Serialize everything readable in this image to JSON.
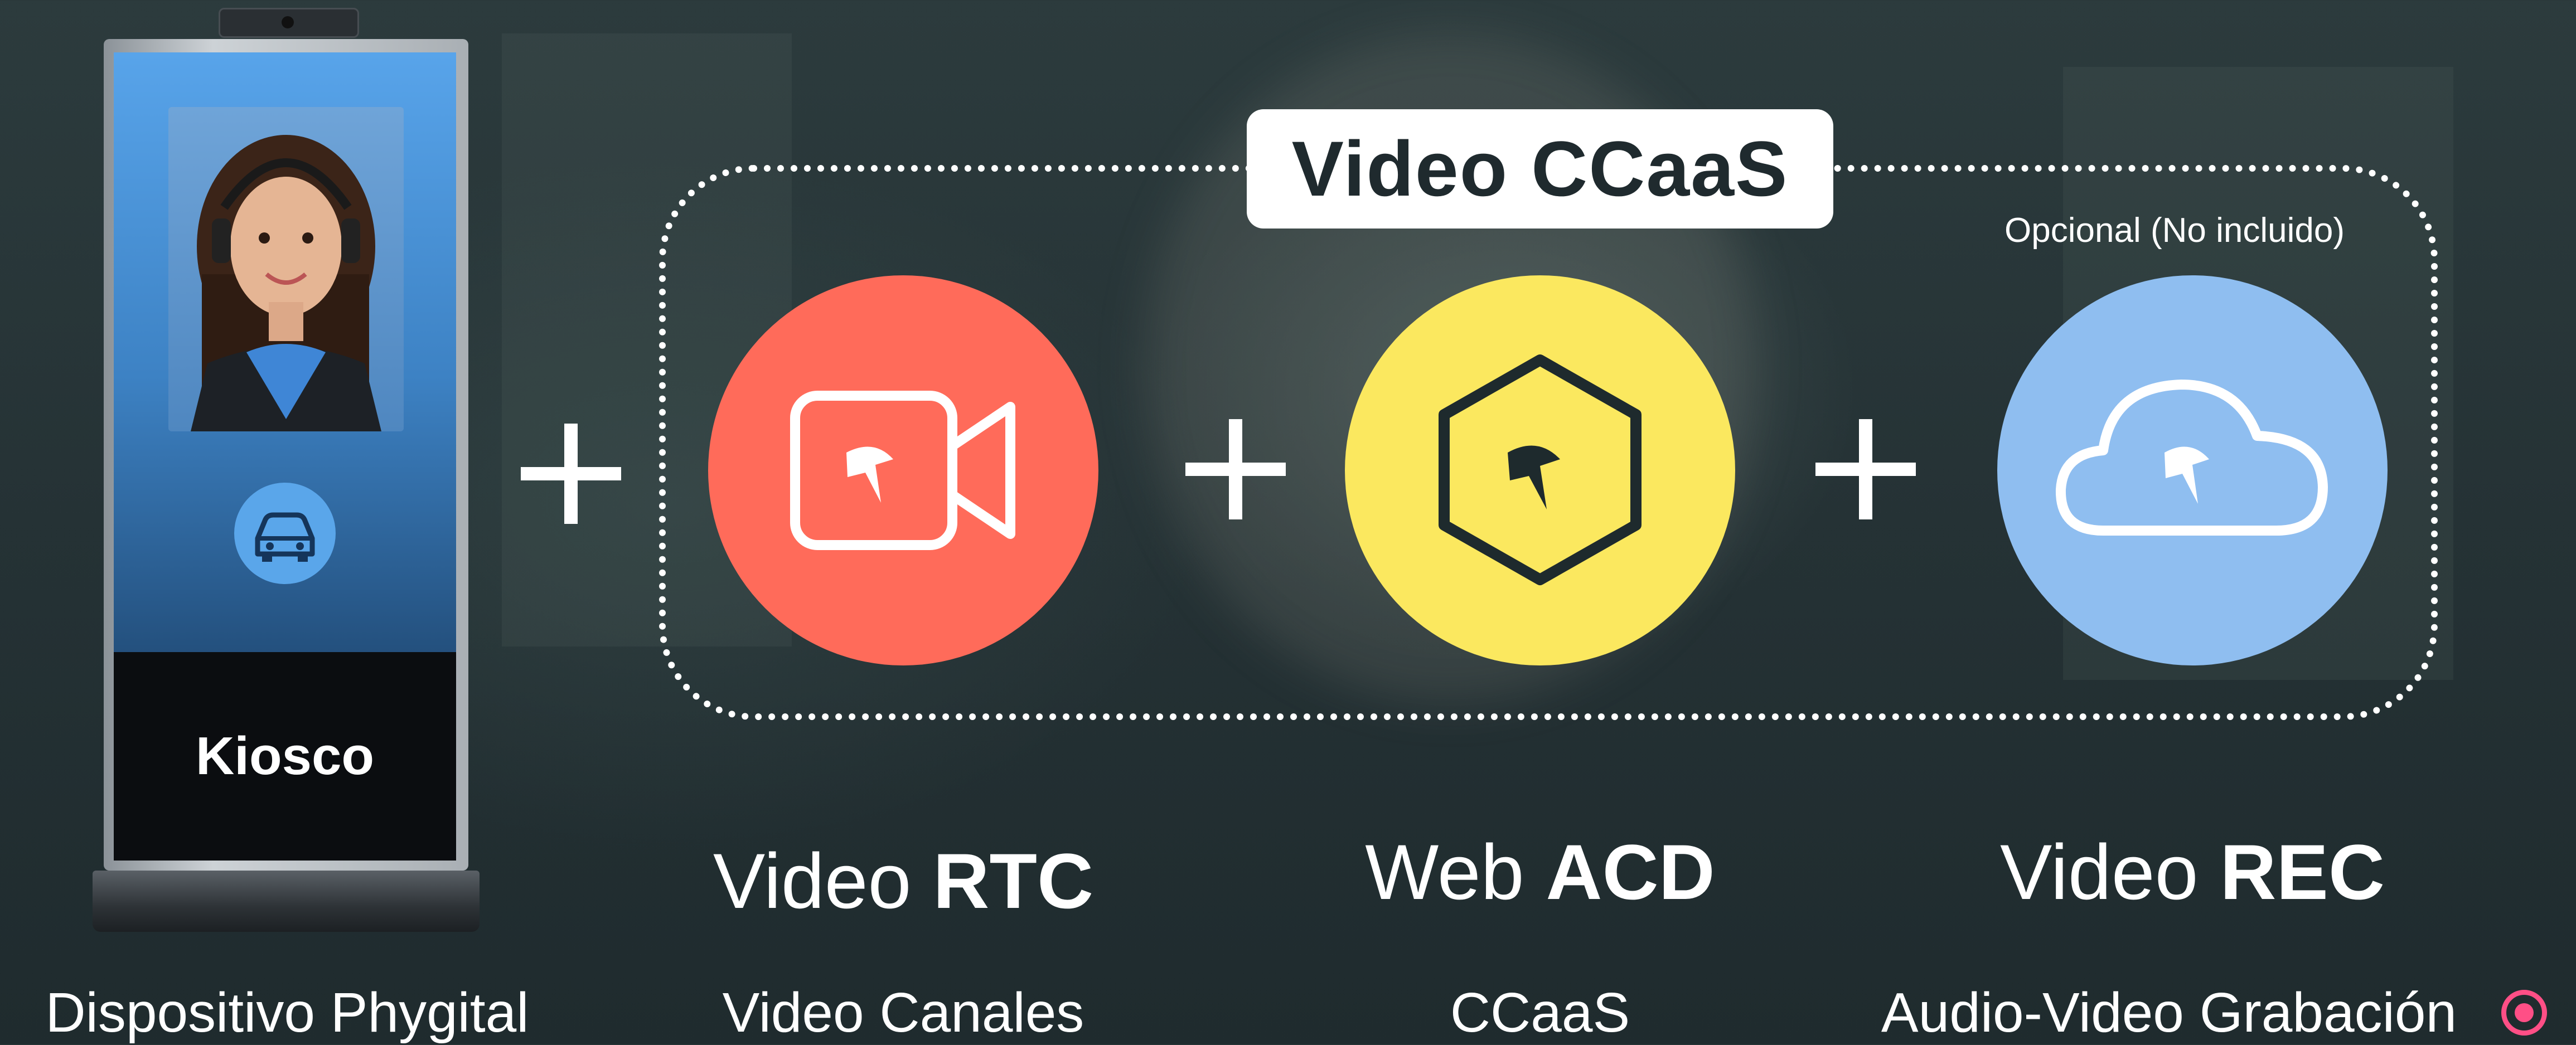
{
  "kiosk": {
    "label": "Kiosco",
    "icon": "car-icon"
  },
  "ccaas": {
    "title": "Video CCaaS",
    "optional_note": "Opcional (No incluido)"
  },
  "products": [
    {
      "name_light": "Video ",
      "name_bold": "RTC",
      "caption": "Video Canales",
      "icon": "video-camera-icon",
      "color": "#ff6b5a"
    },
    {
      "name_light": "Web ",
      "name_bold": "ACD",
      "caption": "CCaaS",
      "icon": "hexagon-icon",
      "color": "#fbe85f"
    },
    {
      "name_light": "Video ",
      "name_bold": "REC",
      "caption": "Audio-Video Grabación",
      "icon": "cloud-icon",
      "color": "#8fbef0"
    }
  ],
  "device_caption": "Dispositivo Phygital",
  "colors": {
    "accent_record": "#ff4f86",
    "background": "#253235"
  }
}
